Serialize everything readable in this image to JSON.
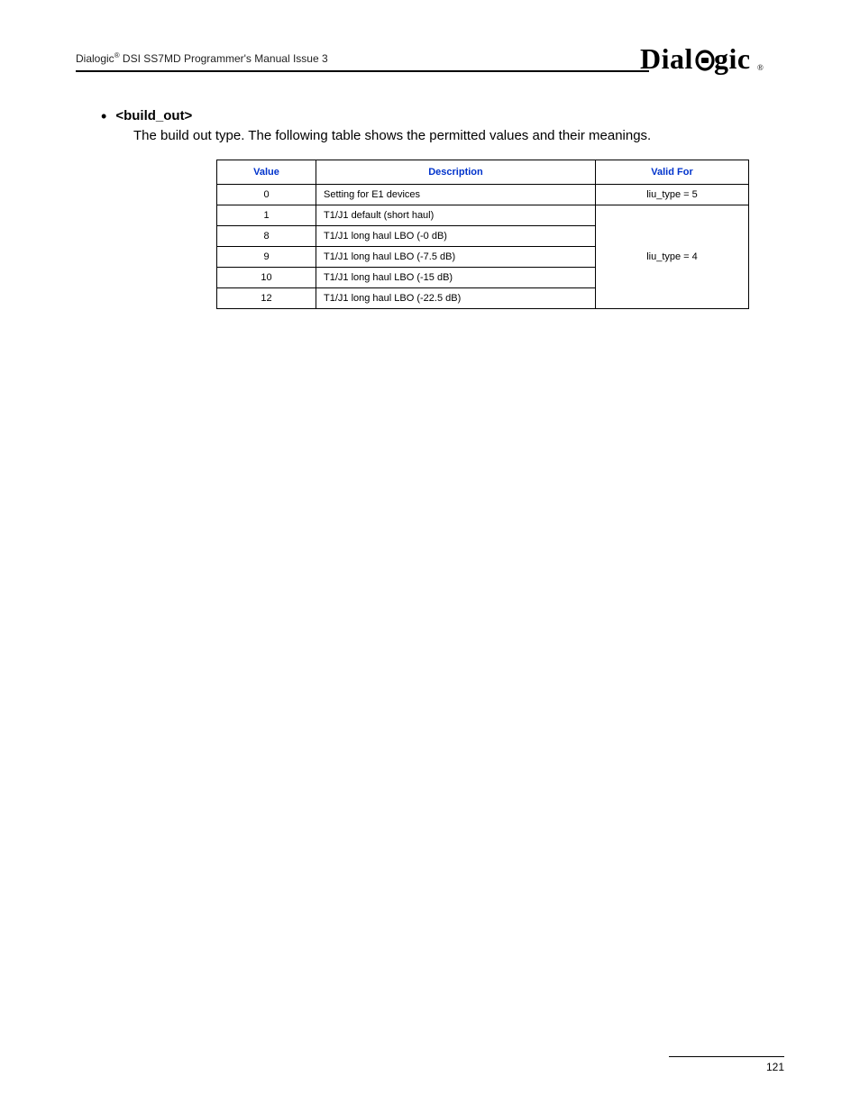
{
  "header": {
    "brand": "Dialogic",
    "reg": "®",
    "title_rest": " DSI SS7MD Programmer's Manual  Issue 3",
    "logo_text": "Dialogic",
    "logo_reg": "®"
  },
  "section": {
    "param": "<build_out>",
    "description": "The build out type. The following table shows the permitted values and their meanings."
  },
  "table": {
    "headers": {
      "value": "Value",
      "description": "Description",
      "valid_for": "Valid For"
    },
    "rows": [
      {
        "value": "0",
        "description": "Setting for E1 devices",
        "valid_for": "liu_type = 5",
        "rowspan": 1
      },
      {
        "value": "1",
        "description": "T1/J1 default (short haul)",
        "valid_for": "liu_type = 4",
        "rowspan": 5
      },
      {
        "value": "8",
        "description": "T1/J1 long haul LBO (-0 dB)"
      },
      {
        "value": "9",
        "description": "T1/J1 long haul LBO (-7.5 dB)"
      },
      {
        "value": "10",
        "description": "T1/J1 long haul LBO (-15 dB)"
      },
      {
        "value": "12",
        "description": "T1/J1 long haul LBO (-22.5 dB)"
      }
    ]
  },
  "footer": {
    "page": "121"
  }
}
